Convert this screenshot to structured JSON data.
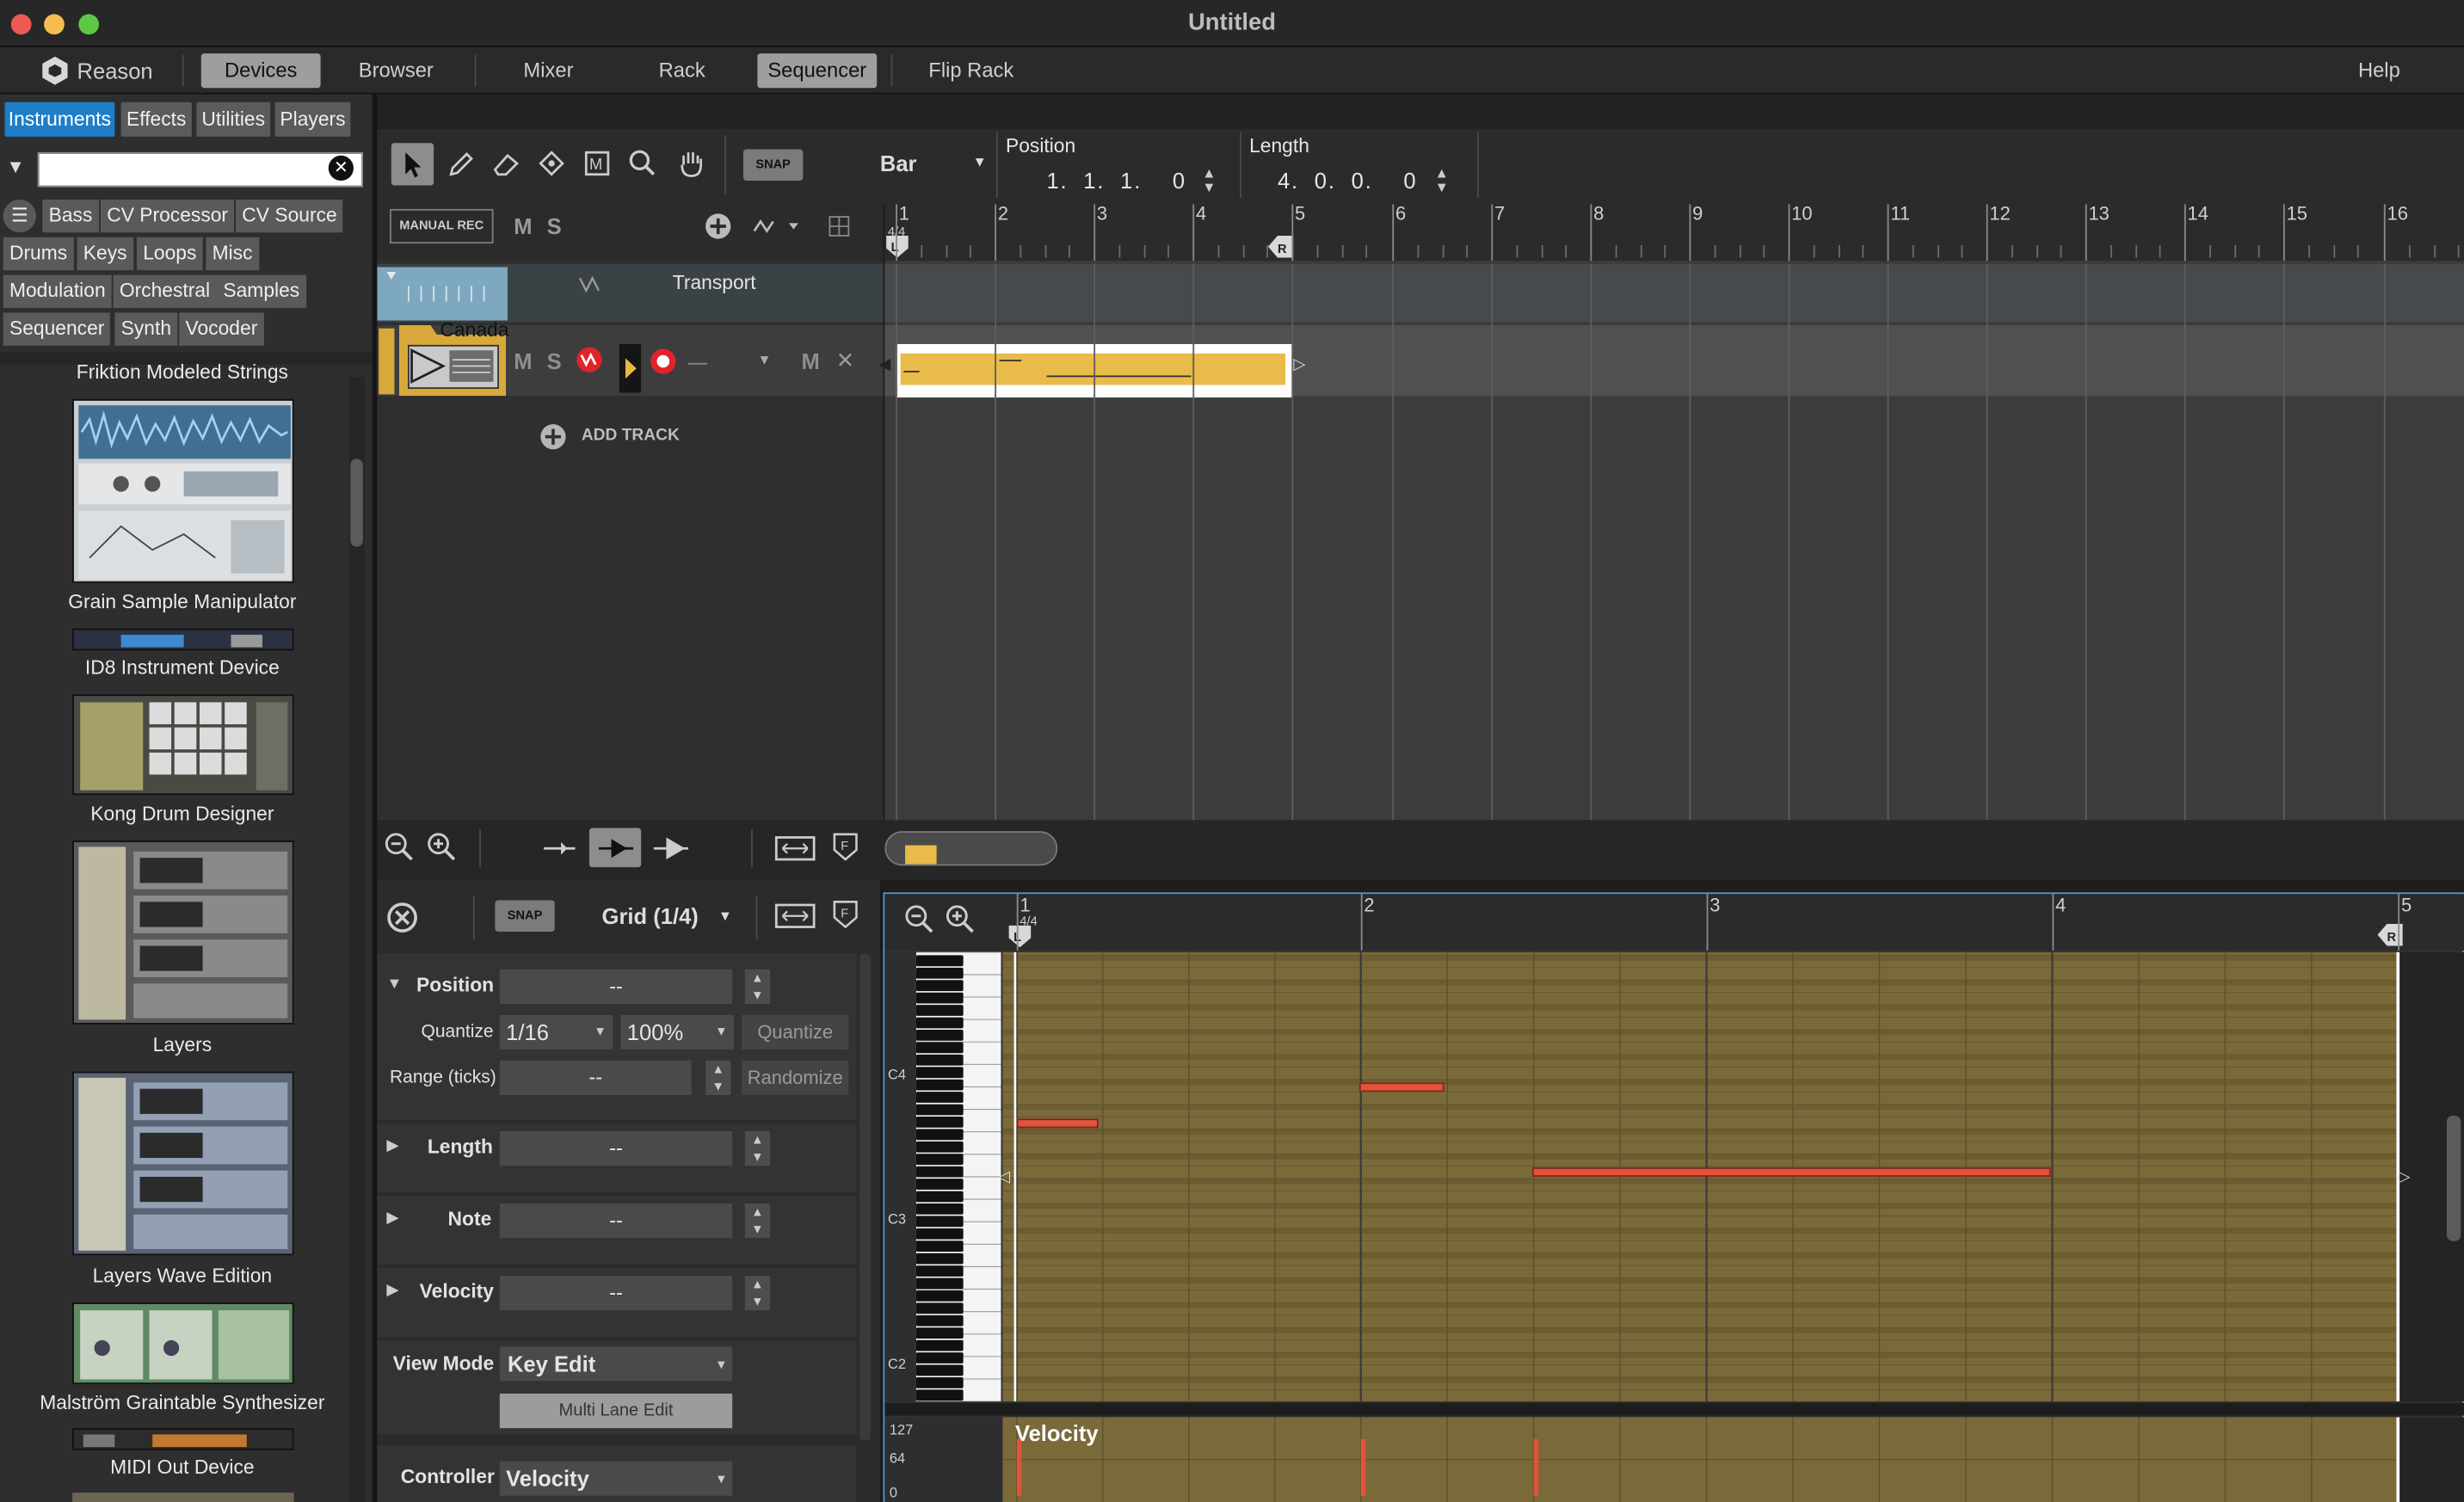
{
  "window": {
    "title": "Untitled"
  },
  "nav": {
    "app_name": "Reason",
    "tabs": [
      "Devices",
      "Browser",
      "Mixer",
      "Rack",
      "Sequencer",
      "Flip Rack"
    ],
    "active_tabs": [
      "Devices",
      "Sequencer"
    ],
    "help": "Help"
  },
  "browser": {
    "tabs": [
      "Instruments",
      "Effects",
      "Utilities",
      "Players"
    ],
    "active_tab": "Instruments",
    "search_value": "",
    "filters": [
      "Bass",
      "CV Processor",
      "CV Source",
      "Drums",
      "Keys",
      "Loops",
      "Misc",
      "Modulation",
      "Orchestral",
      "Samples",
      "Sequencer",
      "Synth",
      "Vocoder"
    ],
    "devices": [
      "Friktion Modeled Strings",
      "Grain Sample Manipulator",
      "ID8 Instrument Device",
      "Kong Drum Designer",
      "Layers",
      "Layers Wave Edition",
      "Malström Graintable Synthesizer",
      "MIDI Out Device"
    ]
  },
  "toolbar": {
    "snap": "SNAP",
    "snap_value": "Bar",
    "position_label": "Position",
    "position_value": "1.  1.  1.    0",
    "length_label": "Length",
    "length_value": "4.  0.  0.    0"
  },
  "tracks": {
    "manual_rec": "MANUAL REC",
    "mute": "M",
    "solo": "S",
    "transport_label": "Transport",
    "track_name": "Canada",
    "add_track": "ADD TRACK",
    "track_m": "M"
  },
  "ruler": {
    "bars": [
      "1",
      "2",
      "3",
      "4",
      "5",
      "6",
      "7",
      "8",
      "9",
      "10",
      "11",
      "12",
      "13",
      "14",
      "15",
      "16"
    ],
    "signature": "4/4",
    "right_marker": "R"
  },
  "editor": {
    "snap": "SNAP",
    "grid": "Grid (1/4)",
    "bars": [
      "1",
      "2",
      "3",
      "4",
      "5"
    ],
    "signature": "4/4",
    "keys": [
      "C4",
      "C3",
      "C2"
    ],
    "velocity_title": "Velocity",
    "velocity_scale": [
      "127",
      "64",
      "0"
    ]
  },
  "inspector": {
    "position_label": "Position",
    "position_value": "--",
    "quantize_label": "Quantize",
    "quantize_value": "1/16",
    "quantize_pct": "100%",
    "quantize_btn": "Quantize",
    "range_label": "Range (ticks)",
    "range_value": "--",
    "randomize_btn": "Randomize",
    "length_label": "Length",
    "length_value": "--",
    "note_label": "Note",
    "note_value": "--",
    "velocity_label": "Velocity",
    "velocity_value": "--",
    "view_mode_label": "View Mode",
    "view_mode_value": "Key Edit",
    "multi_lane": "Multi Lane Edit",
    "controller_label": "Controller",
    "controller_value": "Velocity"
  },
  "colors": {
    "accent_blue": "#1e7ec8",
    "clip_yellow": "#e9bb49",
    "note_red": "#e3533c",
    "track_gold": "#d8a83a"
  }
}
